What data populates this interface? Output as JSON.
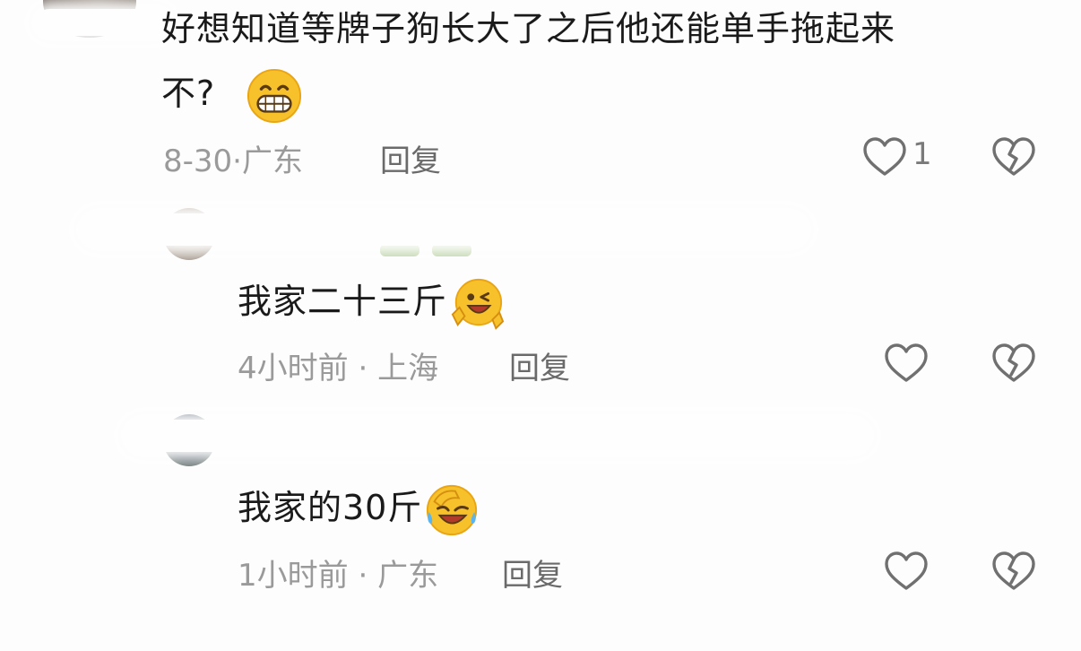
{
  "comment": {
    "text_line1": "好想知道等牌子狗长大了之后他还能单手拖起来",
    "text_line2": "不?",
    "emoji": "grinning-face-emoji",
    "date": "8-30",
    "location": "广东",
    "reply_label": "回复",
    "like_count": "1"
  },
  "replies": [
    {
      "text": "我家二十三斤",
      "emoji": "winking-face-emoji",
      "time": "4小时前",
      "location": "上海",
      "reply_label": "回复"
    },
    {
      "text": "我家的30斤",
      "emoji": "rolling-laughing-emoji",
      "time": "1小时前",
      "location": "广东",
      "reply_label": "回复"
    }
  ],
  "meta_separator": "·",
  "icons": {
    "like": "heart-outline-icon",
    "dislike": "broken-heart-outline-icon"
  },
  "colors": {
    "text": "#1a1a1a",
    "meta": "#9a9a9a",
    "reply": "#6a6a6a",
    "emoji_yellow": "#f7c12c"
  }
}
